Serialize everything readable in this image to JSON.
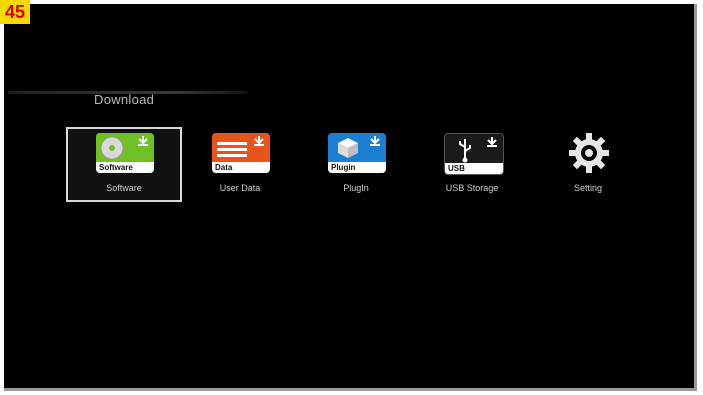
{
  "badge": "45",
  "section": {
    "title": "Download"
  },
  "menu": [
    {
      "label": "Software",
      "icon_text": "Software",
      "icon": "software-disc-icon",
      "color": "#6fbf25",
      "selected": true
    },
    {
      "label": "User Data",
      "icon_text": "Data",
      "icon": "data-list-icon",
      "color": "#e8551c",
      "selected": false
    },
    {
      "label": "PlugIn",
      "icon_text": "Plugin",
      "icon": "plugin-cube-icon",
      "color": "#1d7fd1",
      "selected": false
    },
    {
      "label": "USB Storage",
      "icon_text": "USB",
      "icon": "usb-icon",
      "color": "#1a1a1a",
      "selected": false
    },
    {
      "label": "Setting",
      "icon": "gear-icon",
      "selected": false
    }
  ],
  "colors": {
    "background": "#000000",
    "text": "#cfcfcf",
    "selection_border": "#d8d8d8"
  }
}
